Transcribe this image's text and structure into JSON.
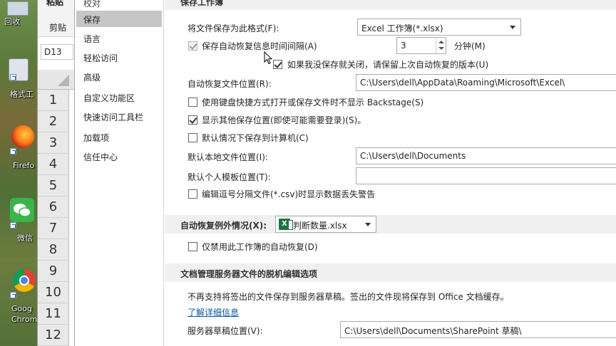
{
  "desktop": {
    "icons": [
      {
        "label": "回收"
      },
      {
        "label": "格式工"
      },
      {
        "label": "Firefo"
      },
      {
        "label": "微信"
      },
      {
        "label": "Goog Chrom"
      }
    ]
  },
  "excel": {
    "ribbon": {
      "paste": "粘贴",
      "clipboard": "剪贴"
    },
    "name_box": "D13",
    "row_headers": [
      "1",
      "2",
      "3",
      "4",
      "5",
      "6",
      "7",
      "8",
      "9",
      "10",
      "11",
      "12"
    ]
  },
  "nav": {
    "items": [
      {
        "label": "校对"
      },
      {
        "label": "保存"
      },
      {
        "label": "语言"
      },
      {
        "label": "轻松访问"
      },
      {
        "label": "高级"
      },
      {
        "label": "自定义功能区"
      },
      {
        "label": "快速访问工具栏"
      },
      {
        "label": "加载项"
      },
      {
        "label": "信任中心"
      }
    ],
    "selected": "保存"
  },
  "save_workbooks": {
    "header": "保存工作簿",
    "format_label": "将文件保存为此格式(F):",
    "format_value": "Excel 工作簿(*.xlsx)",
    "autorecover_interval_label": "保存自动恢复信息时间间隔(A)",
    "autorecover_interval_value": "3",
    "minutes_label": "分钟(M)",
    "keep_last_version_label": "如果我没保存就关闭，请保留上次自动恢复的版本(U)",
    "autorecover_location_label": "自动恢复文件位置(R):",
    "autorecover_location_value": "C:\\Users\\dell\\AppData\\Roaming\\Microsoft\\Excel\\",
    "no_backstage_label": "使用键盘快捷方式打开或保存文件时不显示 Backstage(S)",
    "show_additional_places_label": "显示其他保存位置(即使可能需要登录)(S)。",
    "save_to_computer_label": "默认情况下保存到计算机(C)",
    "default_local_label": "默认本地文件位置(I):",
    "default_local_value": "C:\\Users\\dell\\Documents",
    "default_template_label": "默认个人模板位置(T):",
    "default_template_value": "",
    "csv_warning_label": "编辑逗号分隔文件(*.csv)时显示数据丢失警告"
  },
  "autorecover_exceptions": {
    "header_label": "自动恢复例外情况(X):",
    "workbook": "判断数量.xlsx",
    "disable_label": "仅禁用此工作簿的自动恢复(D)"
  },
  "offline_editing": {
    "header": "文档管理服务器文件的脱机编辑选项",
    "info": "不再支持将签出的文件保存到服务器草稿。签出的文件现将保存到 Office 文档缓存。",
    "learn_more": "了解详细信息",
    "drafts_label": "服务器草稿位置(V):",
    "drafts_value": "C:\\Users\\dell\\Documents\\SharePoint 草稿\\"
  },
  "checkbox_states": {
    "autorecover_interval": true,
    "keep_last_version": true,
    "no_backstage": false,
    "show_additional_places": true,
    "save_to_computer": false,
    "csv_warning": false,
    "disable_autorecover": false
  },
  "colors": {
    "nav_selected": "#c6c6c6",
    "section_header": "#f0f0f0",
    "link": "#0d56a6",
    "excel_green": "#1e7145"
  }
}
